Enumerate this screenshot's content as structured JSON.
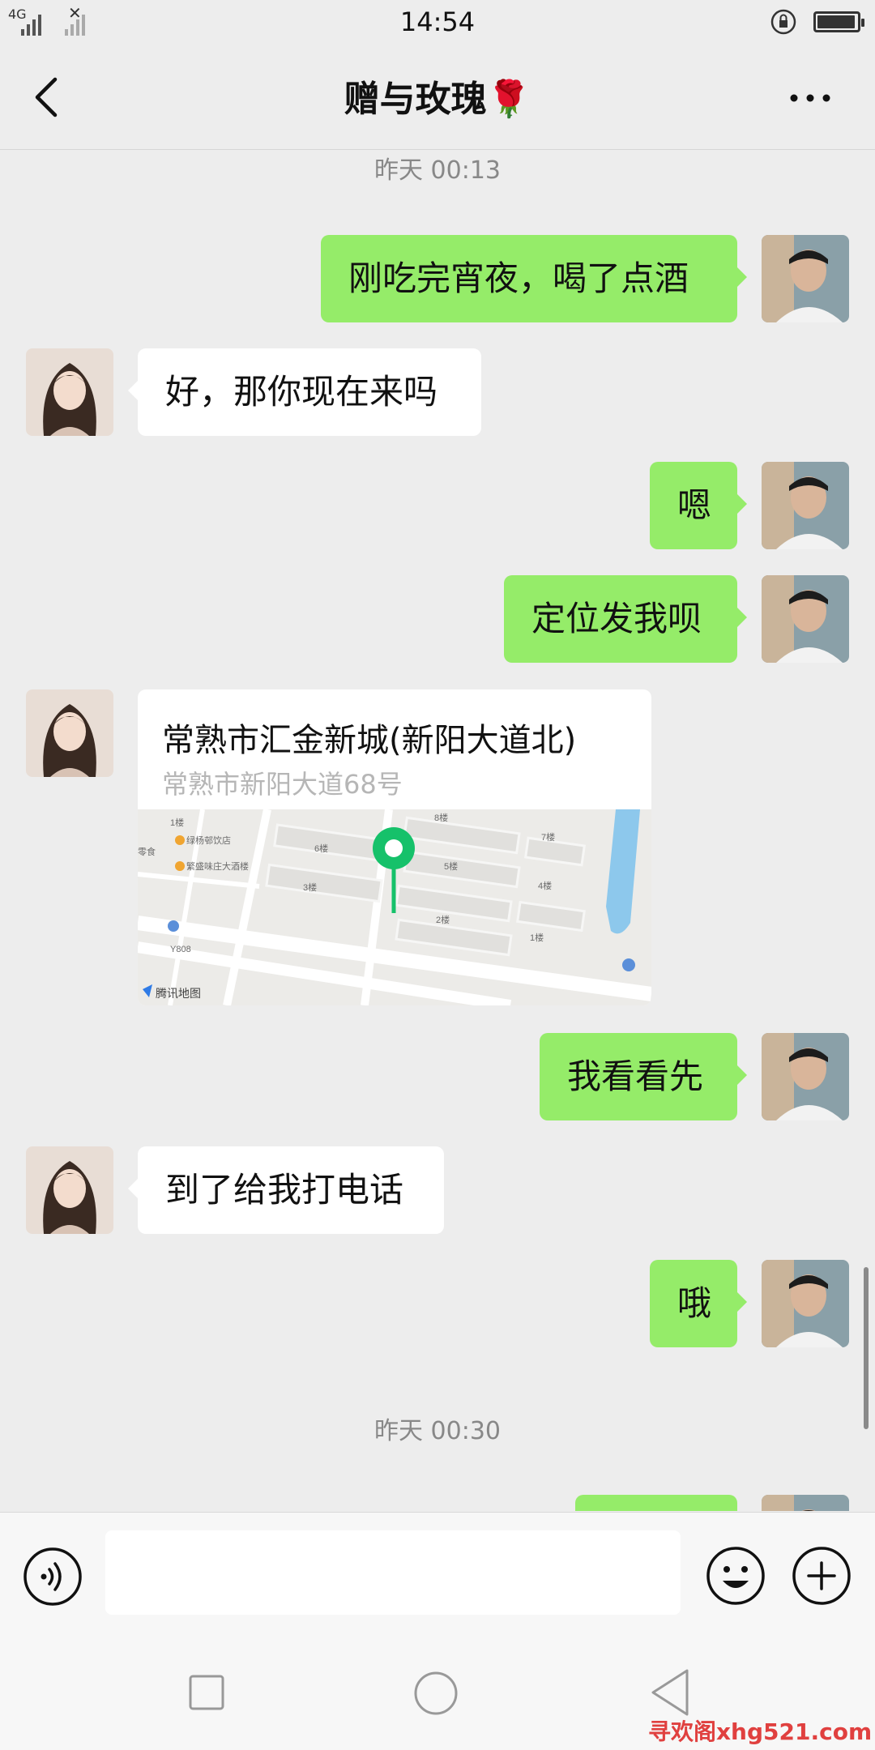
{
  "status_bar": {
    "time": "14:54",
    "network": "4G",
    "battery_level": 0.95
  },
  "header": {
    "title": "赠与玫瑰🌹",
    "back_icon": "chevron-left-icon",
    "more_icon": "more-dots-icon"
  },
  "timestamps": [
    "昨天 00:13",
    "昨天 00:30"
  ],
  "messages": [
    {
      "sender": "me",
      "text": "刚吃完宵夜，喝了点酒"
    },
    {
      "sender": "them",
      "text": "好，那你现在来吗"
    },
    {
      "sender": "me",
      "text": "嗯"
    },
    {
      "sender": "me",
      "text": "定位发我呗"
    },
    {
      "sender": "them",
      "type": "location",
      "title": "常熟市汇金新城(新阳大道北)",
      "address": "常熟市新阳大道68号",
      "map_labels": [
        "1楼",
        "绿杨邨饮店",
        "零食",
        "繁盛味庄大酒楼",
        "6楼",
        "8楼",
        "7楼",
        "5楼",
        "4楼",
        "3楼",
        "2楼",
        "1楼",
        "Y808",
        "腾讯地图"
      ]
    },
    {
      "sender": "me",
      "text": "我看看先"
    },
    {
      "sender": "them",
      "text": "到了给我打电话"
    },
    {
      "sender": "me",
      "text": "哦"
    }
  ],
  "input_bar": {
    "value": "",
    "voice_icon": "voice-icon",
    "emoji_icon": "emoji-icon",
    "plus_icon": "plus-icon"
  },
  "nav_bar": {
    "recent_icon": "square-icon",
    "home_icon": "circle-icon",
    "back_icon": "triangle-back-icon"
  },
  "watermark": "寻欢阁xhg521.com",
  "colors": {
    "my_bubble": "#95ec69",
    "their_bubble": "#ffffff",
    "background": "#ededed",
    "map_pin": "#16c16a"
  }
}
